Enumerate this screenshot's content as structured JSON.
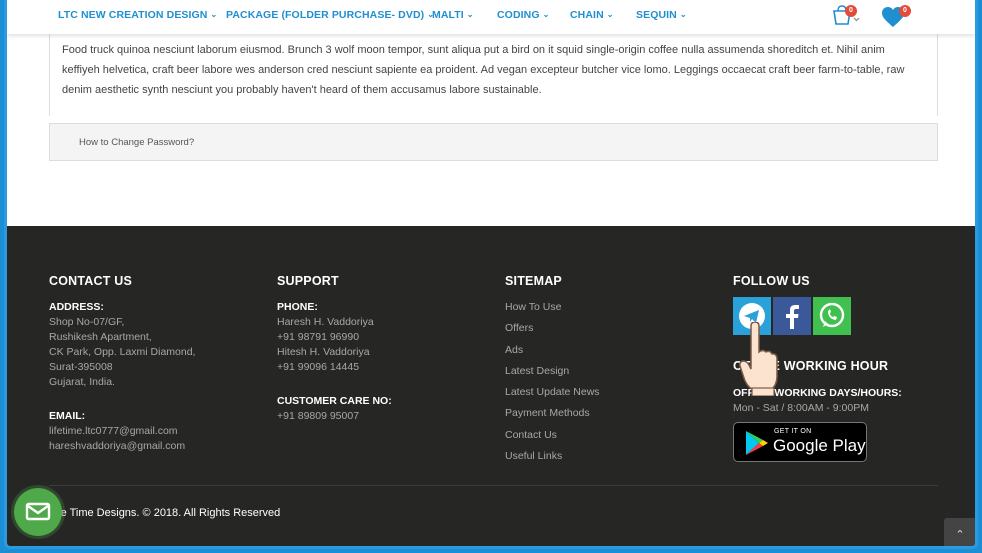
{
  "nav": {
    "items": [
      {
        "label": "LTC NEW CREATION DESIGN"
      },
      {
        "label": "PACKAGE (FOLDER PURCHASE- DVD)"
      },
      {
        "label": "MALTI"
      },
      {
        "label": "CODING"
      },
      {
        "label": "CHAIN"
      },
      {
        "label": "SEQUIN"
      }
    ],
    "cart_count": "0",
    "wishlist_count": "0"
  },
  "content": {
    "paragraph": "Food truck quinoa nesciunt laborum eiusmod. Brunch 3 wolf moon tempor, sunt aliqua put a bird on it squid single-origin coffee nulla assumenda shoreditch et. Nihil anim keffiyeh helvetica, craft beer labore wes anderson cred nesciunt sapiente ea proident. Ad vegan excepteur butcher vice lomo. Leggings occaecat craft beer farm-to-table, raw denim aesthetic synth nesciunt you probably haven't heard of them accusamus labore sustainable.",
    "faq_question": "How to Change Password?"
  },
  "footer": {
    "contact": {
      "title": "CONTACT US",
      "address_label": "ADDRESS:",
      "address_lines": [
        "Shop No-07/GF,",
        "Rushikesh Apartment,",
        "CK Park, Opp. Laxmi Diamond,",
        "Surat-395008",
        "Gujarat, India."
      ],
      "email_label": "EMAIL:",
      "emails": [
        "lifetime.ltc0777@gmail.com",
        "hareshvaddoriya@gmail.com"
      ]
    },
    "support": {
      "title": "SUPPORT",
      "phone_label": "PHONE:",
      "phone_lines": [
        "Haresh H. Vaddoriya",
        "+91 98791 96990",
        "Hitesh H. Vaddoriya",
        "+91 99096 14445"
      ],
      "care_label": "CUSTOMER CARE NO:",
      "care_number": "+91 89809 95007"
    },
    "sitemap": {
      "title": "SITEMAP",
      "links": [
        "How To Use",
        "Offers",
        "Ads",
        "Latest Design",
        "Latest Update News",
        "Payment Methods",
        "Contact Us",
        "Useful Links"
      ]
    },
    "follow": {
      "title": "FOLLOW US",
      "social_icons": [
        "telegram-icon",
        "facebook-icon",
        "whatsapp-icon"
      ],
      "hours_title": "OFFICE WORKING HOUR",
      "hours_label": "OFFICE WORKING DAYS/HOURS:",
      "hours_value": "Mon - Sat / 8:00AM - 9:00PM",
      "gplay_top": "GET IT ON",
      "gplay_bottom": "Google Play"
    },
    "copyright": "Life Time Designs. © 2018. All Rights Reserved"
  },
  "colors": {
    "nav_text": "#1f8fd0",
    "footer_bg": "#262724",
    "telegram": "#2aa1d9",
    "facebook": "#3b5998",
    "whatsapp": "#3fc04f",
    "chat": "#4fa84a",
    "frame": "#1c8ed6"
  }
}
